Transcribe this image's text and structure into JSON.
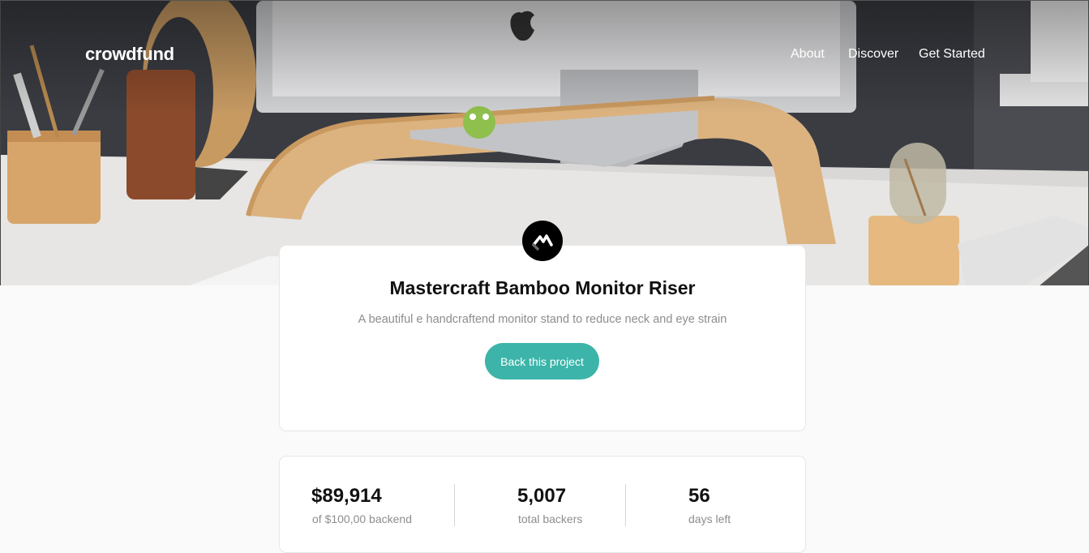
{
  "header": {
    "logo": "crowdfund",
    "nav": [
      {
        "label": "About"
      },
      {
        "label": "Discover"
      },
      {
        "label": "Get Started"
      }
    ]
  },
  "project": {
    "title": "Mastercraft Bamboo Monitor Riser",
    "description": "A beautiful e handcraftend monitor stand to reduce neck and eye strain",
    "back_button": "Back this project"
  },
  "stats": [
    {
      "value": "$89,914",
      "label": "of $100,00 backend"
    },
    {
      "value": "5,007",
      "label": "total backers"
    },
    {
      "value": "56",
      "label": "days left"
    }
  ],
  "colors": {
    "accent": "#3cb4a9",
    "background": "#fafafa",
    "card": "#ffffff"
  }
}
